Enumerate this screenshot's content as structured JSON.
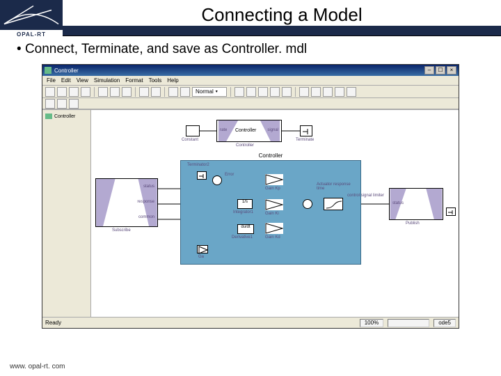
{
  "slide": {
    "title": "Connecting a Model",
    "bullet": "Connect, Terminate, and save as Controller. mdl",
    "footer": "www. opal-rt. com",
    "logo_text": "OPAL-RT"
  },
  "app": {
    "window_title": "Controller",
    "menu": [
      "File",
      "Edit",
      "View",
      "Simulation",
      "Format",
      "Tools",
      "Help"
    ],
    "toolbar_dropdown": "Normal",
    "sidebar_item": "Controller",
    "status": {
      "ready": "Ready",
      "zoom": "100%",
      "mode": "ode5"
    }
  },
  "top_model": {
    "constant_label": "Constant",
    "subsys_label": "Controller",
    "term_label": "Terminate",
    "port_in": "rate",
    "port_out": "signal",
    "subsys_title": "Controller"
  },
  "left_subsys": {
    "ports": [
      "status",
      "response",
      "common"
    ],
    "label": "Subscribe"
  },
  "right_subsys": {
    "ports": [
      "status"
    ],
    "label": "Publish"
  },
  "controller": {
    "panel_title": "Controller",
    "terminator2": "Terminator2",
    "error": "Error",
    "integrator": "Integrator1",
    "derivative": "Derivative1",
    "ga": "Ga",
    "gain_kp": "Gain Kp",
    "gain_ki": "Gain Ki",
    "gain_kd": "Gain Kd",
    "actuator": "Actuator response time",
    "out_signal": "control signal limiter",
    "int_text": "1/s",
    "deriv_text": "du/dt",
    "gain_a": ">",
    "sum_plus": "+"
  }
}
